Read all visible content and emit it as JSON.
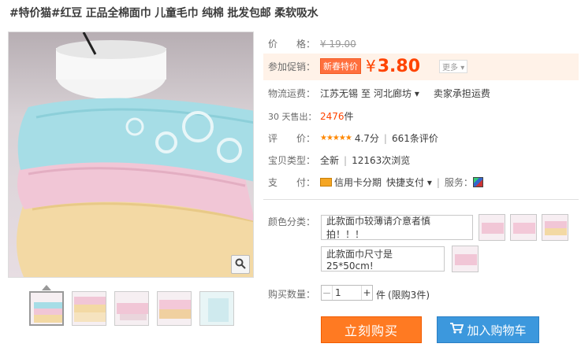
{
  "product": {
    "title": "#特价猫#红豆 正品全棉面巾 儿童毛巾 纯棉 批发包邮 柔软吸水"
  },
  "gallery": {
    "thumb_count": 5,
    "zoom_icon": "magnifier-icon"
  },
  "price": {
    "label": "价　　格：",
    "original": "¥ 19.00"
  },
  "promo": {
    "label": "参加促销：",
    "badge": "新春特价",
    "currency": "¥",
    "value": "3.80",
    "more": "更多 ▾"
  },
  "shipping": {
    "label": "物流运费：",
    "from": "江苏无锡",
    "to_prefix": "至",
    "to": "河北廊坊 ▾",
    "fee": "卖家承担运费"
  },
  "sales": {
    "label": "30 天售出：",
    "count": "2476",
    "unit": "件"
  },
  "rating": {
    "label": "评　　价：",
    "stars": "★★★★★",
    "score": "4.7分",
    "sep": "|",
    "reviews": "661条评价"
  },
  "type": {
    "label": "宝贝类型：",
    "value": "全新",
    "sep": "|",
    "views": "12163次浏览"
  },
  "payment": {
    "label": "支　　付：",
    "credit": "信用卡分期",
    "quick": "快捷支付 ▾",
    "sep": "|",
    "service_label": "服务："
  },
  "sku": {
    "label": "颜色分类：",
    "option1": "此款面巾较薄请介意者慎拍！！！",
    "option2": "此款面巾尺寸是25*50cm!"
  },
  "quantity": {
    "label": "购买数量：",
    "minus": "－",
    "value": "1",
    "plus": "+",
    "unit": "件",
    "limit": "(限购3件)"
  },
  "actions": {
    "buy_now": "立刻购买",
    "add_to_cart": "加入购物车"
  },
  "colors": {
    "price_accent": "#ff4400",
    "buy_button": "#ff7a22",
    "cart_button": "#3c98dd"
  }
}
